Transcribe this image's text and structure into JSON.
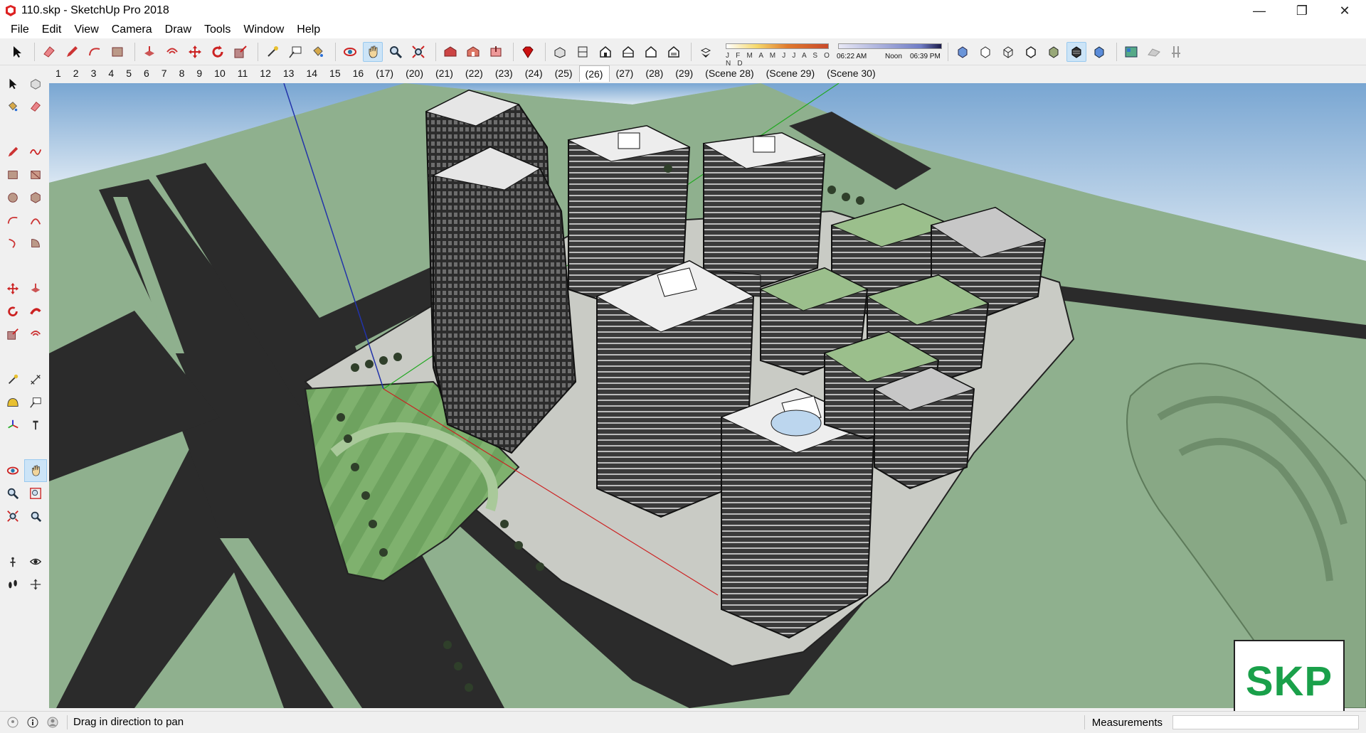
{
  "window": {
    "title": "110.skp - SketchUp Pro 2018",
    "minimize": "—",
    "restore": "❐",
    "close": "✕"
  },
  "menu": [
    "File",
    "Edit",
    "View",
    "Camera",
    "Draw",
    "Tools",
    "Window",
    "Help"
  ],
  "shadow": {
    "months": "J F M A M J J A S O N D",
    "time_start": "06:22 AM",
    "time_mid": "Noon",
    "time_end": "06:39 PM"
  },
  "scenes": [
    "1",
    "2",
    "3",
    "4",
    "5",
    "6",
    "7",
    "8",
    "9",
    "10",
    "11",
    "12",
    "13",
    "14",
    "15",
    "16",
    "(17)",
    "(20)",
    "(21)",
    "(22)",
    "(23)",
    "(24)",
    "(25)",
    "(26)",
    "(27)",
    "(28)",
    "(29)",
    "(Scene 28)",
    "(Scene 29)",
    "(Scene 30)"
  ],
  "active_scene_index": 23,
  "logo_text": "SKP",
  "status": {
    "hint": "Drag in direction to pan",
    "measurements_label": "Measurements",
    "measurements_value": ""
  },
  "colors": {
    "ground": "#8fb08e",
    "road": "#2b2b2b",
    "sky_top": "#7da9d4",
    "logo_green": "#1aa04a"
  }
}
